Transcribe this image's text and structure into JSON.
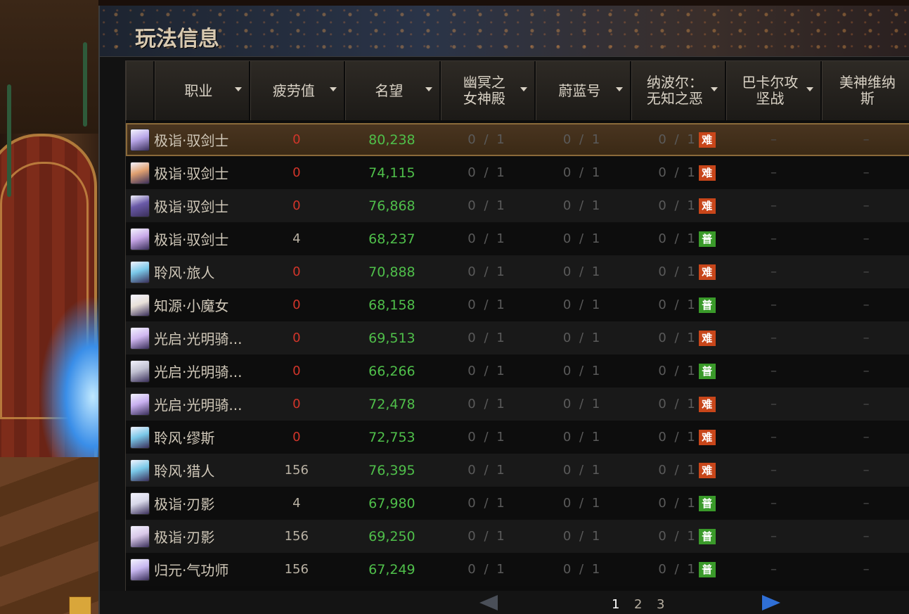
{
  "panel": {
    "title": "玩法信息"
  },
  "columns": [
    {
      "key": "name",
      "label": "职业"
    },
    {
      "key": "fatigue",
      "label": "疲劳值"
    },
    {
      "key": "fame",
      "label": "名望"
    },
    {
      "key": "d1",
      "label": "幽冥之\n女神殿"
    },
    {
      "key": "d2",
      "label": "蔚蓝号"
    },
    {
      "key": "d3",
      "label": "纳波尔：\n无知之恶"
    },
    {
      "key": "d4",
      "label": "巴卡尔攻\n坚战"
    },
    {
      "key": "d5",
      "label": "美神维纳\n斯"
    }
  ],
  "rows": [
    {
      "name": "极诣·驭剑士",
      "fatigue": "0",
      "fame": "80,238",
      "d1": "0 / 1",
      "d2": "0 / 1",
      "d3": "0 / 1",
      "badge": "难",
      "d4": "–",
      "d5": "–",
      "selected": true
    },
    {
      "name": "极诣·驭剑士",
      "fatigue": "0",
      "fame": "74,115",
      "d1": "0 / 1",
      "d2": "0 / 1",
      "d3": "0 / 1",
      "badge": "难",
      "d4": "–",
      "d5": "–"
    },
    {
      "name": "极诣·驭剑士",
      "fatigue": "0",
      "fame": "76,868",
      "d1": "0 / 1",
      "d2": "0 / 1",
      "d3": "0 / 1",
      "badge": "难",
      "d4": "–",
      "d5": "–"
    },
    {
      "name": "极诣·驭剑士",
      "fatigue": "4",
      "fame": "68,237",
      "d1": "0 / 1",
      "d2": "0 / 1",
      "d3": "0 / 1",
      "badge": "普",
      "d4": "–",
      "d5": "–"
    },
    {
      "name": "聆风·旅人",
      "fatigue": "0",
      "fame": "70,888",
      "d1": "0 / 1",
      "d2": "0 / 1",
      "d3": "0 / 1",
      "badge": "难",
      "d4": "–",
      "d5": "–"
    },
    {
      "name": "知源·小魔女",
      "fatigue": "0",
      "fame": "68,158",
      "d1": "0 / 1",
      "d2": "0 / 1",
      "d3": "0 / 1",
      "badge": "普",
      "d4": "–",
      "d5": "–"
    },
    {
      "name": "光启·光明骑...",
      "fatigue": "0",
      "fame": "69,513",
      "d1": "0 / 1",
      "d2": "0 / 1",
      "d3": "0 / 1",
      "badge": "难",
      "d4": "–",
      "d5": "–"
    },
    {
      "name": "光启·光明骑...",
      "fatigue": "0",
      "fame": "66,266",
      "d1": "0 / 1",
      "d2": "0 / 1",
      "d3": "0 / 1",
      "badge": "普",
      "d4": "–",
      "d5": "–"
    },
    {
      "name": "光启·光明骑...",
      "fatigue": "0",
      "fame": "72,478",
      "d1": "0 / 1",
      "d2": "0 / 1",
      "d3": "0 / 1",
      "badge": "难",
      "d4": "–",
      "d5": "–"
    },
    {
      "name": "聆风·缪斯",
      "fatigue": "0",
      "fame": "72,753",
      "d1": "0 / 1",
      "d2": "0 / 1",
      "d3": "0 / 1",
      "badge": "难",
      "d4": "–",
      "d5": "–"
    },
    {
      "name": "聆风·猎人",
      "fatigue": "156",
      "fame": "76,395",
      "d1": "0 / 1",
      "d2": "0 / 1",
      "d3": "0 / 1",
      "badge": "难",
      "d4": "–",
      "d5": "–"
    },
    {
      "name": "极诣·刃影",
      "fatigue": "4",
      "fame": "67,980",
      "d1": "0 / 1",
      "d2": "0 / 1",
      "d3": "0 / 1",
      "badge": "普",
      "d4": "–",
      "d5": "–"
    },
    {
      "name": "极诣·刃影",
      "fatigue": "156",
      "fame": "69,250",
      "d1": "0 / 1",
      "d2": "0 / 1",
      "d3": "0 / 1",
      "badge": "普",
      "d4": "–",
      "d5": "–"
    },
    {
      "name": "归元·气功师",
      "fatigue": "156",
      "fame": "67,249",
      "d1": "0 / 1",
      "d2": "0 / 1",
      "d3": "0 / 1",
      "badge": "普",
      "d4": "–",
      "d5": "–"
    }
  ],
  "pagination": {
    "pages": [
      "1",
      "2",
      "3"
    ],
    "current": "1"
  },
  "colors": {
    "fame": "#4fbf4a",
    "fatigue_zero": "#d2352a",
    "badge_hard": "#c8461a",
    "badge_normal": "#3a9a2a"
  }
}
